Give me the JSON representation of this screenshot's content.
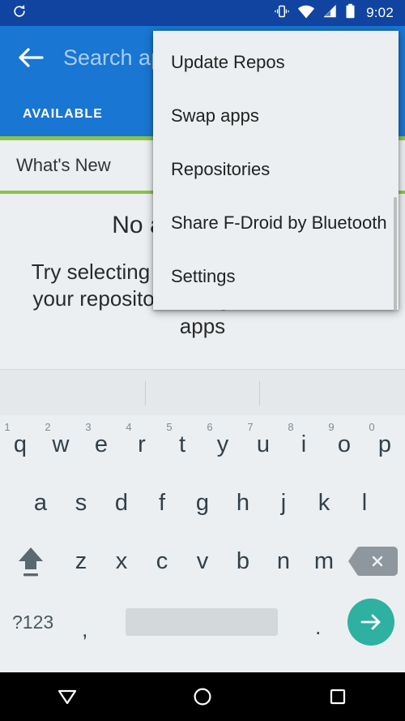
{
  "status_bar": {
    "sync_icon": "refresh-icon",
    "vibrate_icon": "vibrate-icon",
    "wifi_icon": "wifi-icon",
    "signal_icon": "cellular-signal-icon",
    "battery_icon": "battery-icon",
    "clock": "9:02",
    "background_color": "#1044a0"
  },
  "app_bar": {
    "back_icon": "back-arrow-icon",
    "search_placeholder": "Search apps",
    "search_value": "",
    "background_color": "#1976d2"
  },
  "tabs": {
    "items": [
      {
        "label": "AVAILABLE",
        "selected": true
      }
    ],
    "indicator_color": "#8bc34a"
  },
  "content": {
    "section_header": "What's New",
    "empty_title": "No apps to show",
    "empty_body": "Try selecting more repos or updating your repositories to get a fresh list of apps",
    "background_color": "#eceff1"
  },
  "overflow_menu": {
    "items": [
      {
        "label": "Update Repos"
      },
      {
        "label": "Swap apps"
      },
      {
        "label": "Repositories"
      },
      {
        "label": "Share F-Droid by Bluetooth"
      },
      {
        "label": "Settings"
      }
    ],
    "background_color": "#eceff1"
  },
  "keyboard": {
    "suggestions": [
      "",
      "",
      ""
    ],
    "row_top": [
      {
        "key": "q",
        "num": "1"
      },
      {
        "key": "w",
        "num": "2"
      },
      {
        "key": "e",
        "num": "3"
      },
      {
        "key": "r",
        "num": "4"
      },
      {
        "key": "t",
        "num": "5"
      },
      {
        "key": "y",
        "num": "6"
      },
      {
        "key": "u",
        "num": "7"
      },
      {
        "key": "i",
        "num": "8"
      },
      {
        "key": "o",
        "num": "9"
      },
      {
        "key": "p",
        "num": "0"
      }
    ],
    "row_home": [
      "a",
      "s",
      "d",
      "f",
      "g",
      "h",
      "j",
      "k",
      "l"
    ],
    "row_bottom": [
      "z",
      "x",
      "c",
      "v",
      "b",
      "n",
      "m"
    ],
    "shift_icon": "shift-icon",
    "backspace_icon": "backspace-icon",
    "symbols_label": "?123",
    "comma_label": ",",
    "period_label": ".",
    "enter_icon": "enter-arrow-icon",
    "enter_color": "#2eb1a1",
    "background_color": "#eceff1"
  },
  "nav_bar": {
    "back_icon": "nav-back-triangle-icon",
    "home_icon": "nav-home-circle-icon",
    "recents_icon": "nav-recents-square-icon",
    "background_color": "#000000"
  }
}
